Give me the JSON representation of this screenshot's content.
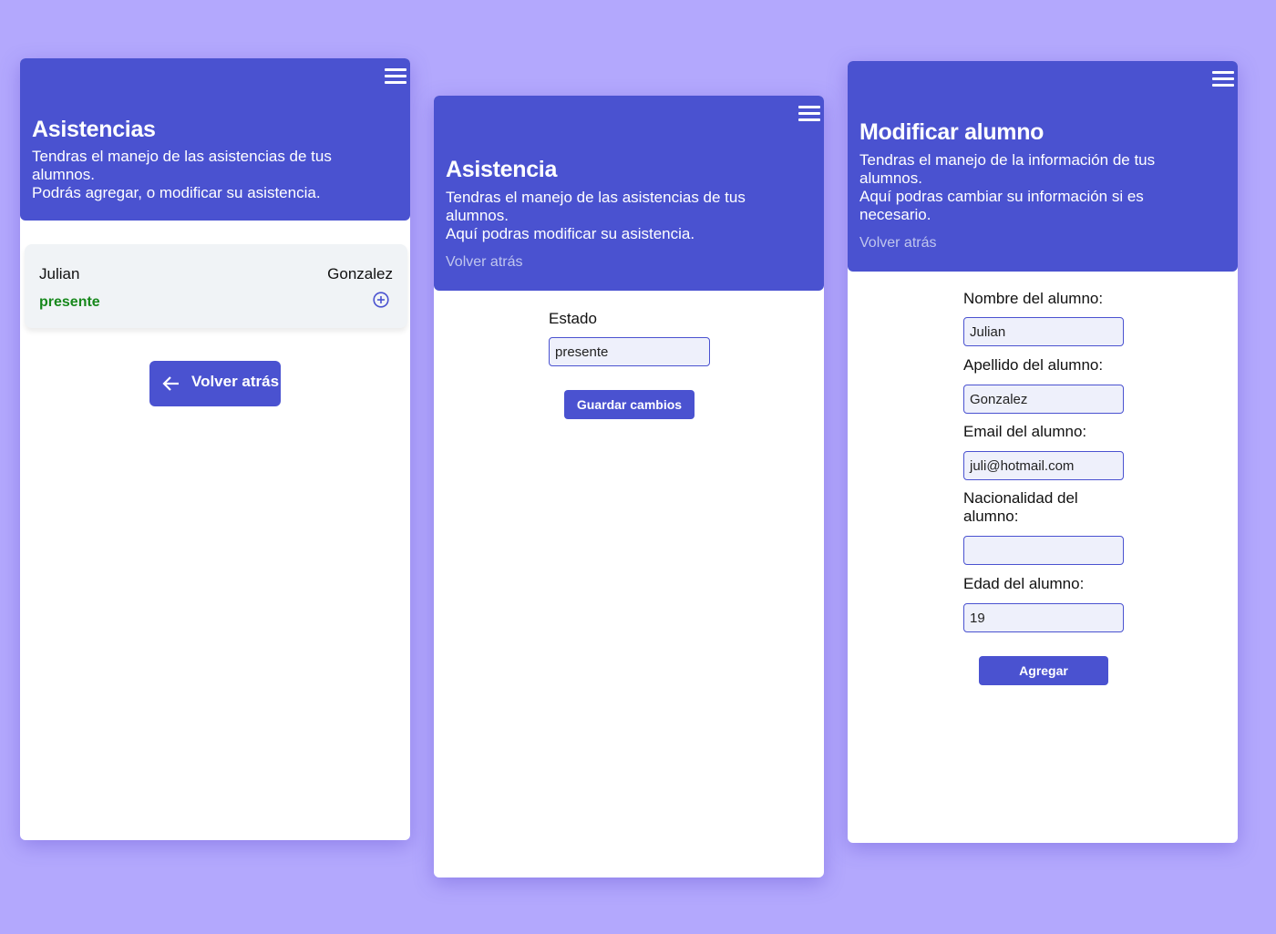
{
  "screen1": {
    "title": "Asistencias",
    "description": [
      "Tendras el manejo de las asistencias de tus",
      "alumnos.",
      "Podrás agregar, o modificar su asistencia."
    ],
    "student": {
      "first_name": "Julian",
      "last_name": "Gonzalez",
      "status": "presente"
    },
    "back_button": "Volver atrás"
  },
  "screen2": {
    "title": "Asistencia",
    "description": [
      "Tendras el manejo de las asistencias de tus",
      "alumnos.",
      "Aquí podras modificar su asistencia."
    ],
    "back_link": "Volver atrás",
    "field_label": "Estado",
    "field_value": "presente",
    "save_button": "Guardar cambios"
  },
  "screen3": {
    "title": "Modificar alumno",
    "description": [
      "Tendras el manejo de la información de tus",
      "alumnos.",
      "Aquí podras cambiar su información si es",
      "necesario."
    ],
    "back_link": "Volver atrás",
    "fields": [
      {
        "label": "Nombre del alumno:",
        "value": "Julian"
      },
      {
        "label": "Apellido del alumno:",
        "value": "Gonzalez"
      },
      {
        "label": "Email del alumno:",
        "value": "juli@hotmail.com"
      },
      {
        "label_lines": [
          "Nacionalidad del",
          "alumno:"
        ],
        "value": ""
      },
      {
        "label": "Edad del alumno:",
        "value": "19"
      }
    ],
    "submit_button": "Agregar"
  },
  "colors": {
    "background": "#b3a8fd",
    "primary": "#4a52d0",
    "present": "#17881c"
  },
  "icons": [
    "menu-icon",
    "plus-circle-icon",
    "arrow-left-icon"
  ]
}
